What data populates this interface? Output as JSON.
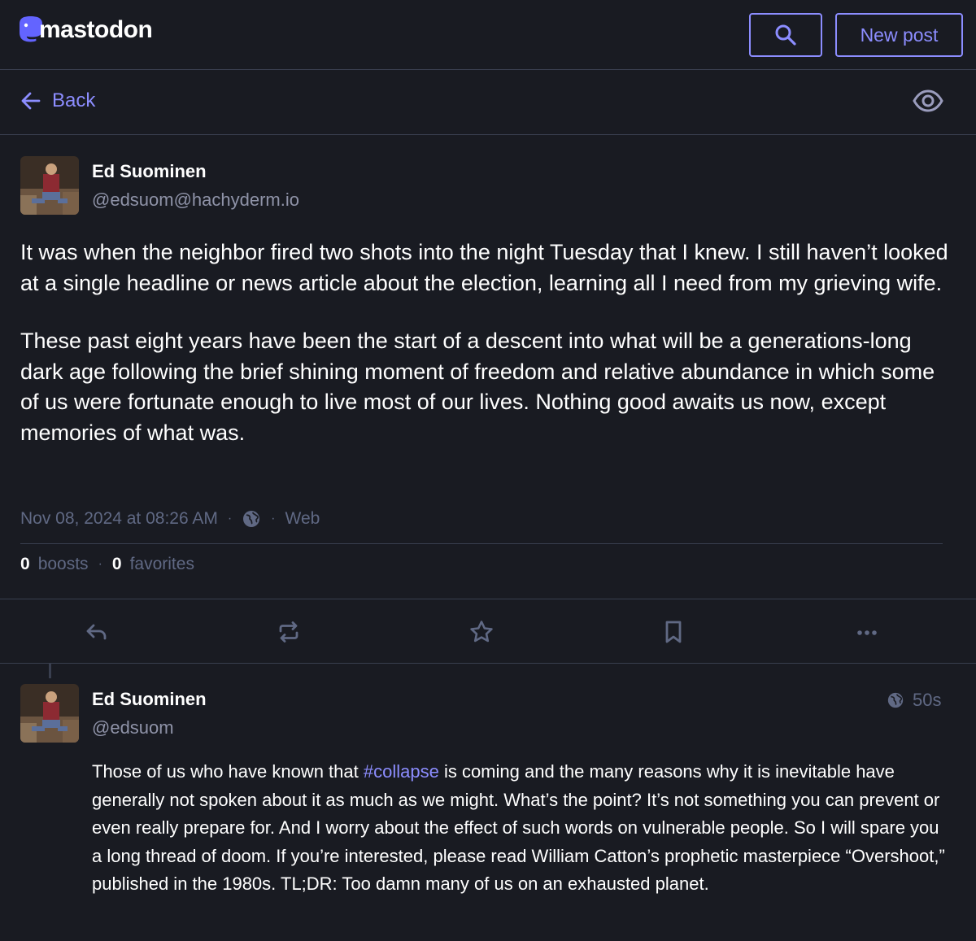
{
  "header": {
    "logo_text": "mastodon",
    "search_icon": "search-icon",
    "new_post_label": "New post",
    "accent_color": "#8c8dff"
  },
  "backbar": {
    "back_label": "Back",
    "back_icon": "arrow-left-icon",
    "visibility_icon": "eye-icon"
  },
  "status": {
    "display_name": "Ed Suominen",
    "acct": "@edsuom@hachyderm.io",
    "paragraphs": [
      "It was when the neighbor fired two shots into the night Tuesday that I knew. I still haven’t looked at a single headline or news article about the election, learning all I need from my grieving wife.",
      "These past eight years have been the start of a descent into what will be a generations-long dark age following the brief shining moment of freedom and relative abundance in which some of us were fortunate enough to live most of our lives. Nothing good awaits us now, except memories of what was."
    ],
    "timestamp": "Nov 08, 2024 at 08:26 AM",
    "visibility_icon": "globe-icon",
    "application": "Web",
    "boosts_count": "0",
    "boosts_label": "boosts",
    "favorites_count": "0",
    "favorites_label": "favorites"
  },
  "actions": [
    "reply-icon",
    "boost-icon",
    "star-icon",
    "bookmark-icon",
    "more-icon"
  ],
  "reply": {
    "display_name": "Ed Suominen",
    "acct": "@edsuom",
    "relative_time": "50s",
    "text_before": "Those of us who have known that ",
    "hashtag": "#collapse",
    "text_after": " is coming and the many reasons why it is inevitable have generally not spoken about it as much as we might. What’s the point? It’s not something you can prevent or even really prepare for. And I worry about the effect of such words on vulnerable people. So I will spare you a long thread of doom. If you’re interested, please read William Catton’s prophetic masterpiece “Overshoot,” published in the 1980s. TL;DR: Too damn many of us on an exhausted planet."
  }
}
